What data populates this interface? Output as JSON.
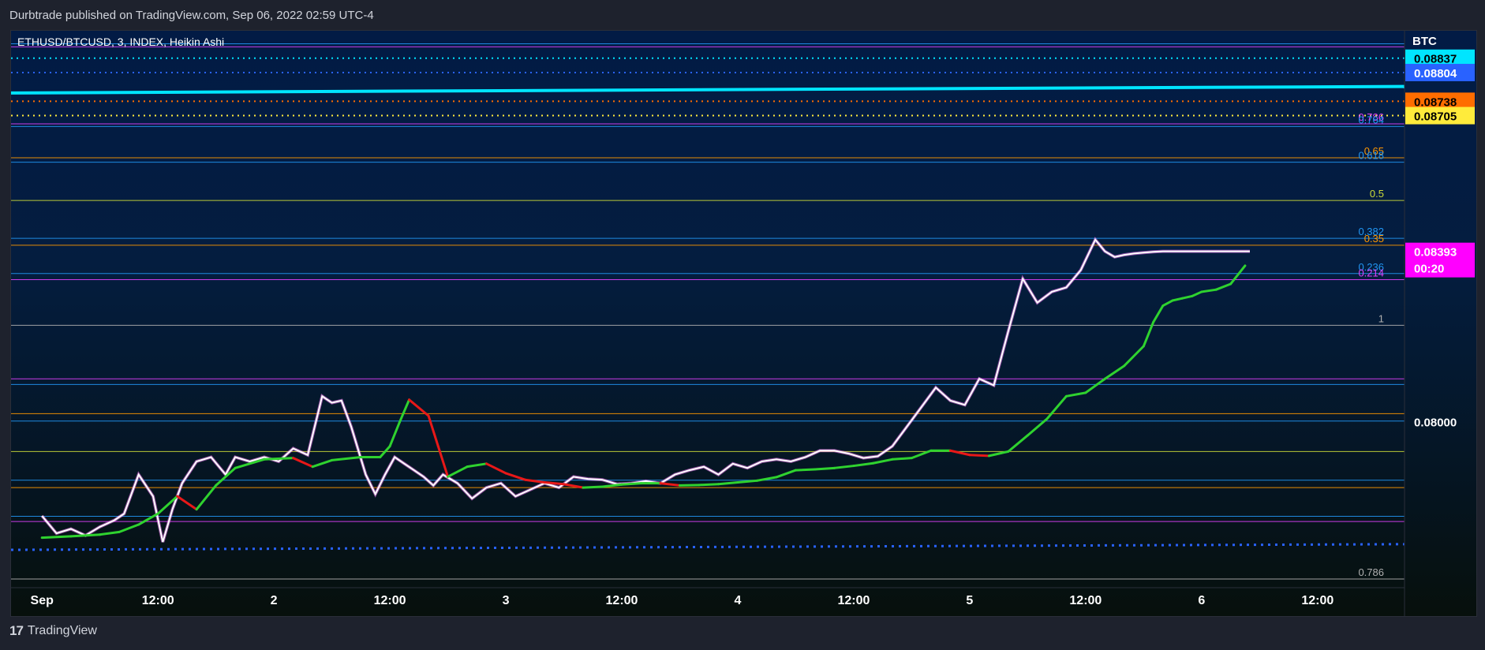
{
  "header": {
    "published": "Durbtrade published on TradingView.com, Sep 06, 2022 02:59 UTC-4"
  },
  "footer": {
    "brand": "TradingView",
    "logo_icon": "tradingview-logo-icon"
  },
  "chart_data": {
    "type": "line",
    "title": "ETHUSD/BTCUSD, 3, INDEX, Heikin Ashi",
    "currency": "BTC",
    "ylim": [
      0.0762,
      0.089
    ],
    "x_tick_labels": [
      "Sep",
      "12:00",
      "2",
      "12:00",
      "3",
      "12:00",
      "4",
      "12:00",
      "5",
      "12:00",
      "6",
      "12:00"
    ],
    "x_tick_index": [
      0,
      240,
      480,
      720,
      960,
      1200,
      1440,
      1680,
      1920,
      2160,
      2400,
      2640
    ],
    "xlim": [
      -64,
      2820
    ],
    "y_axis_labels": [
      "0.08000"
    ],
    "price_tags": [
      {
        "value": 0.08837,
        "label": "0.08837",
        "color": "#00e5ff",
        "text_color": "#000000"
      },
      {
        "value": 0.08804,
        "label": "0.08804",
        "color": "#2962ff",
        "text_color": "#ffffff"
      },
      {
        "value": 0.08738,
        "label": "0.08738",
        "color": "#ff6d00",
        "text_color": "#000000"
      },
      {
        "value": 0.08705,
        "label": "0.08705",
        "color": "#ffeb3b",
        "text_color": "#000000"
      },
      {
        "value": 0.08393,
        "label": "0.08393",
        "sub": "00:20",
        "color": "#ff00ff",
        "text_color": "#ffffff"
      }
    ],
    "fib_levels": [
      {
        "value": 0.0887,
        "label": "",
        "color": "#2196f3"
      },
      {
        "value": 0.08863,
        "label": "",
        "color": "#e040fb"
      },
      {
        "value": 0.08686,
        "label": "0.786",
        "color": "#e040fb"
      },
      {
        "value": 0.0868,
        "label": "0.764",
        "color": "#2196f3"
      },
      {
        "value": 0.08608,
        "label": "0.65",
        "color": "#ff9800"
      },
      {
        "value": 0.08598,
        "label": "0.618",
        "color": "#2196f3"
      },
      {
        "value": 0.0851,
        "label": "0.5",
        "color": "#cddc39"
      },
      {
        "value": 0.08423,
        "label": "0.382",
        "color": "#2196f3"
      },
      {
        "value": 0.08407,
        "label": "0.35",
        "color": "#ff9800"
      },
      {
        "value": 0.08342,
        "label": "0.236",
        "color": "#2196f3"
      },
      {
        "value": 0.08328,
        "label": "0.214",
        "color": "#e040fb"
      },
      {
        "value": 0.08223,
        "label": "1",
        "color": "#b0b0b0"
      },
      {
        "value": 0.081,
        "label": "",
        "color": "#e040fb"
      },
      {
        "value": 0.08087,
        "label": "",
        "color": "#2196f3"
      },
      {
        "value": 0.0802,
        "label": "",
        "color": "#ff9800"
      },
      {
        "value": 0.08003,
        "label": "",
        "color": "#2196f3"
      },
      {
        "value": 0.07933,
        "label": "",
        "color": "#cddc39"
      },
      {
        "value": 0.07867,
        "label": "",
        "color": "#2196f3"
      },
      {
        "value": 0.0785,
        "label": "",
        "color": "#ff9800"
      },
      {
        "value": 0.07784,
        "label": "",
        "color": "#2196f3"
      },
      {
        "value": 0.07772,
        "label": "",
        "color": "#e040fb"
      },
      {
        "value": 0.0764,
        "label": "0.786",
        "color": "#b0b0b0"
      }
    ],
    "dotted_lines": [
      {
        "value": 0.08837,
        "color": "#00e5ff"
      },
      {
        "value": 0.08804,
        "color": "#2962ff"
      },
      {
        "value": 0.08738,
        "color": "#ff6d00"
      },
      {
        "value": 0.08705,
        "color": "#ffeb3b"
      },
      {
        "value1": 0.07707,
        "value2": 0.0772,
        "color": "#2962ff"
      }
    ],
    "trend_line": {
      "value_start": 0.08757,
      "value_end": 0.08772,
      "color": "#00e5ff"
    },
    "ma_series": {
      "name": "",
      "x": [
        0,
        60,
        120,
        160,
        200,
        240,
        280,
        320,
        360,
        400,
        460,
        520,
        560,
        600,
        660,
        700,
        720,
        740,
        760,
        800,
        820,
        840,
        880,
        920,
        960,
        1000,
        1040,
        1080,
        1120,
        1160,
        1200,
        1240,
        1280,
        1320,
        1360,
        1400,
        1440,
        1480,
        1520,
        1560,
        1600,
        1640,
        1680,
        1720,
        1760,
        1800,
        1840,
        1880,
        1920,
        1960,
        2000,
        2040,
        2080,
        2120,
        2160,
        2200,
        2240,
        2280,
        2300,
        2320,
        2340,
        2360,
        2380,
        2400,
        2430,
        2460,
        2490
      ],
      "y": [
        0.07735,
        0.07738,
        0.07742,
        0.07748,
        0.07765,
        0.0779,
        0.0783,
        0.078,
        0.07855,
        0.07895,
        0.07915,
        0.07918,
        0.07898,
        0.07913,
        0.0792,
        0.0792,
        0.07945,
        0.08,
        0.08052,
        0.08015,
        0.07945,
        0.07875,
        0.07898,
        0.07905,
        0.07883,
        0.07868,
        0.07862,
        0.07858,
        0.0785,
        0.07852,
        0.07857,
        0.0786,
        0.0786,
        0.07855,
        0.07856,
        0.07858,
        0.07862,
        0.07866,
        0.07874,
        0.0789,
        0.07892,
        0.07895,
        0.079,
        0.07906,
        0.07915,
        0.07918,
        0.07935,
        0.07935,
        0.07925,
        0.07923,
        0.07933,
        0.0797,
        0.08008,
        0.0806,
        0.08068,
        0.081,
        0.0813,
        0.08175,
        0.0823,
        0.08268,
        0.0828,
        0.08285,
        0.0829,
        0.083,
        0.08305,
        0.08318,
        0.0836
      ],
      "colors": [
        "red",
        "green"
      ]
    },
    "price_series": {
      "name": "",
      "x": [
        0,
        30,
        60,
        90,
        120,
        150,
        170,
        200,
        230,
        250,
        270,
        290,
        320,
        350,
        380,
        400,
        430,
        460,
        490,
        520,
        550,
        580,
        600,
        620,
        640,
        670,
        690,
        710,
        730,
        750,
        770,
        790,
        810,
        830,
        860,
        890,
        920,
        950,
        980,
        1010,
        1040,
        1070,
        1100,
        1130,
        1160,
        1190,
        1220,
        1250,
        1280,
        1310,
        1340,
        1370,
        1400,
        1430,
        1460,
        1490,
        1520,
        1550,
        1580,
        1610,
        1640,
        1670,
        1700,
        1730,
        1760,
        1790,
        1820,
        1850,
        1880,
        1910,
        1940,
        1970,
        2000,
        2030,
        2060,
        2090,
        2120,
        2150,
        2180,
        2200,
        2220,
        2240,
        2260,
        2280,
        2300,
        2320,
        2340,
        2360,
        2380,
        2400,
        2420,
        2440,
        2460,
        2480,
        2500
      ],
      "y": [
        0.07785,
        0.07745,
        0.07755,
        0.0774,
        0.0776,
        0.07775,
        0.0779,
        0.0788,
        0.0783,
        0.07725,
        0.078,
        0.0786,
        0.0791,
        0.0792,
        0.0788,
        0.0792,
        0.0791,
        0.0792,
        0.0791,
        0.0794,
        0.07925,
        0.0806,
        0.08045,
        0.0805,
        0.0799,
        0.0788,
        0.07835,
        0.0788,
        0.0792,
        0.07905,
        0.0789,
        0.07875,
        0.07855,
        0.0788,
        0.0786,
        0.07825,
        0.0785,
        0.0786,
        0.0783,
        0.07845,
        0.0786,
        0.0785,
        0.07875,
        0.0787,
        0.07868,
        0.07858,
        0.0786,
        0.07865,
        0.0786,
        0.0788,
        0.0789,
        0.07898,
        0.0788,
        0.07905,
        0.07895,
        0.0791,
        0.07915,
        0.0791,
        0.0792,
        0.07935,
        0.07935,
        0.07928,
        0.07918,
        0.07922,
        0.07945,
        0.0799,
        0.08035,
        0.0808,
        0.0805,
        0.0804,
        0.081,
        0.08085,
        0.0821,
        0.0833,
        0.08275,
        0.083,
        0.0831,
        0.0835,
        0.0842,
        0.08393,
        0.0838,
        0.08385,
        0.08388,
        0.0839,
        0.08392,
        0.08393,
        0.08393,
        0.08393,
        0.08393,
        0.08393,
        0.08393,
        0.08393,
        0.08393,
        0.08393,
        0.08393
      ],
      "color": "#ffffff"
    },
    "grid": false,
    "legend": "none"
  }
}
